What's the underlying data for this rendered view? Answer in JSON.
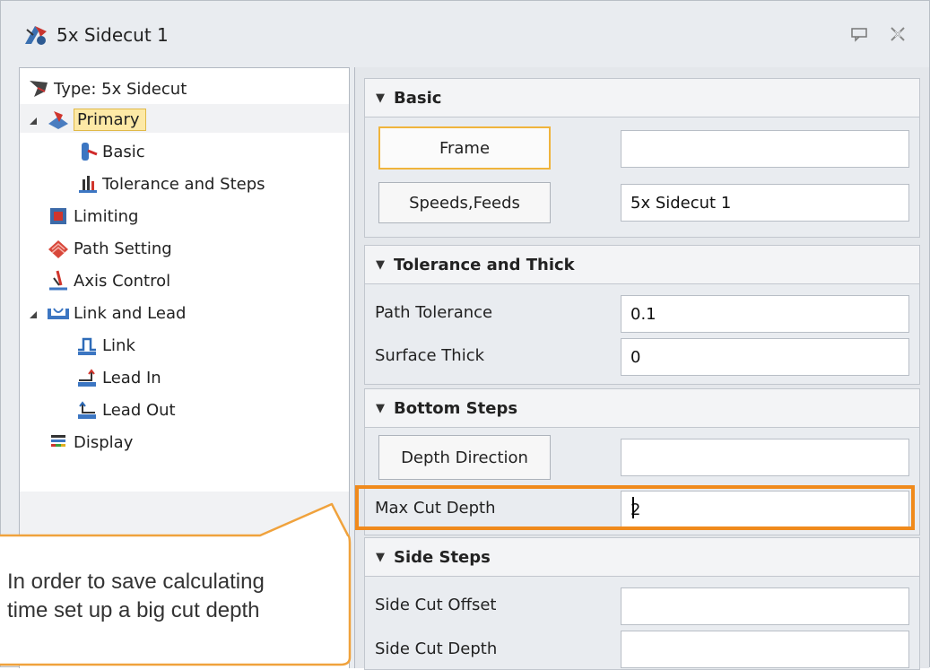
{
  "window": {
    "title": "5x Sidecut 1"
  },
  "icons": {
    "app": "5x-sidecut-icon",
    "pin": "pin-icon",
    "close": "close-icon",
    "type": "tool-type-icon",
    "primary": "primary-icon",
    "basic": "basic-icon",
    "tolerance": "tolerance-icon",
    "limiting": "limiting-icon",
    "path": "path-setting-icon",
    "axis": "axis-control-icon",
    "linklead": "link-lead-icon",
    "link": "link-icon",
    "leadin": "lead-in-icon",
    "leadout": "lead-out-icon",
    "display": "display-icon"
  },
  "tree": {
    "type_label": "Type: 5x Sidecut",
    "primary": "Primary",
    "basic": "Basic",
    "tolerance_steps": "Tolerance and Steps",
    "limiting": "Limiting",
    "path_setting": "Path Setting",
    "axis_control": "Axis Control",
    "link_and_lead": "Link and Lead",
    "link": "Link",
    "lead_in": "Lead In",
    "lead_out": "Lead Out",
    "display": "Display"
  },
  "sections": {
    "basic": {
      "title": "Basic",
      "frame_button": "Frame",
      "frame_value": "",
      "speeds_button": "Speeds,Feeds",
      "speeds_value": "5x Sidecut  1"
    },
    "tolerance": {
      "title": "Tolerance and Thick",
      "path_tolerance_label": "Path Tolerance",
      "path_tolerance_value": "0.1",
      "surface_thick_label": "Surface Thick",
      "surface_thick_value": "0"
    },
    "bottom_steps": {
      "title": "Bottom Steps",
      "depth_direction_button": "Depth Direction",
      "depth_direction_value": "",
      "max_cut_depth_label": "Max Cut Depth",
      "max_cut_depth_value": "2"
    },
    "side_steps": {
      "title": "Side Steps",
      "side_cut_offset_label": "Side Cut Offset",
      "side_cut_offset_value": "",
      "side_cut_depth_label": "Side Cut Depth",
      "side_cut_depth_value": ""
    }
  },
  "callout": {
    "line1": "In order to save calculating",
    "line2": "time set up a big cut depth"
  },
  "colors": {
    "highlight": "#f08a1c",
    "callout_border": "#f0a23c",
    "selection": "#fde9a6"
  }
}
